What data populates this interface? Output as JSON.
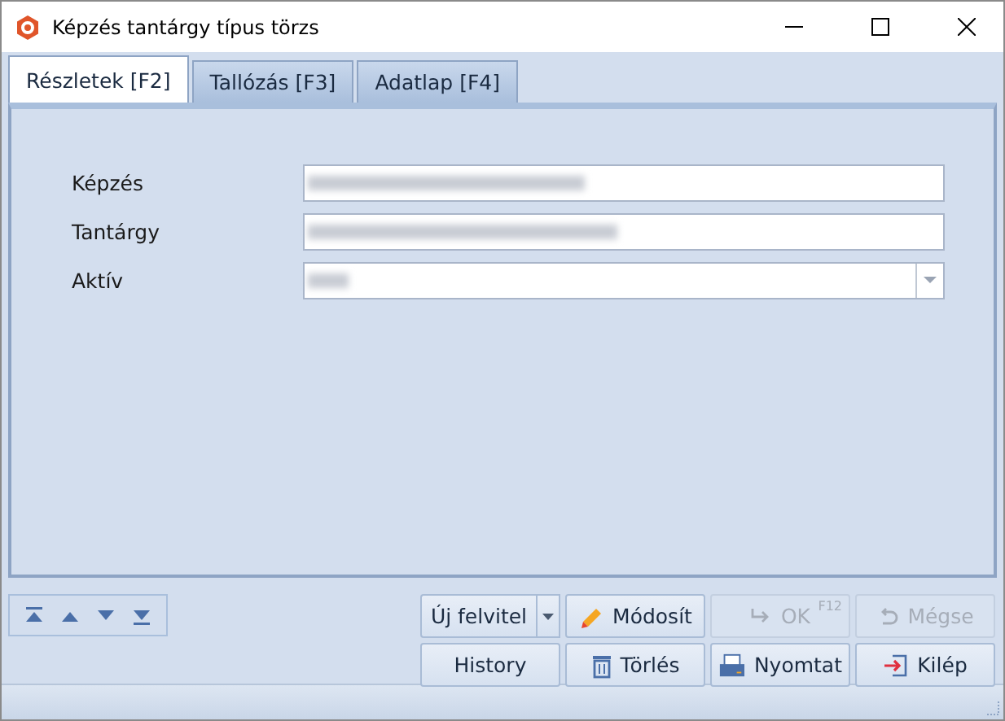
{
  "window": {
    "title": "Képzés tantárgy típus törzs"
  },
  "tabs": [
    {
      "label": "Részletek [F2]",
      "selected": true
    },
    {
      "label": "Tallózás [F3]",
      "selected": false
    },
    {
      "label": "Adatlap [F4]",
      "selected": false
    }
  ],
  "fields": [
    {
      "label": "Képzés",
      "kind": "text"
    },
    {
      "label": "Tantárgy",
      "kind": "text"
    },
    {
      "label": "Aktív",
      "kind": "dropdown"
    }
  ],
  "nav_buttons": [
    {
      "kind": "first"
    },
    {
      "kind": "up"
    },
    {
      "kind": "down"
    },
    {
      "kind": "last"
    }
  ],
  "buttons": [
    {
      "label": "Új felvitel",
      "kind": "split",
      "disabled": false
    },
    {
      "label": "Módosít",
      "kind": "edit",
      "disabled": false
    },
    {
      "label": "OK",
      "kind": "ok",
      "disabled": true,
      "shortcut": "F12"
    },
    {
      "label": "Mégse",
      "kind": "cancel",
      "disabled": true
    },
    {
      "label": "History",
      "kind": "plain",
      "disabled": false
    },
    {
      "label": "Törlés",
      "kind": "delete",
      "disabled": false
    },
    {
      "label": "Nyomtat",
      "kind": "print",
      "disabled": false
    },
    {
      "label": "Kilép",
      "kind": "exit",
      "disabled": false
    }
  ]
}
